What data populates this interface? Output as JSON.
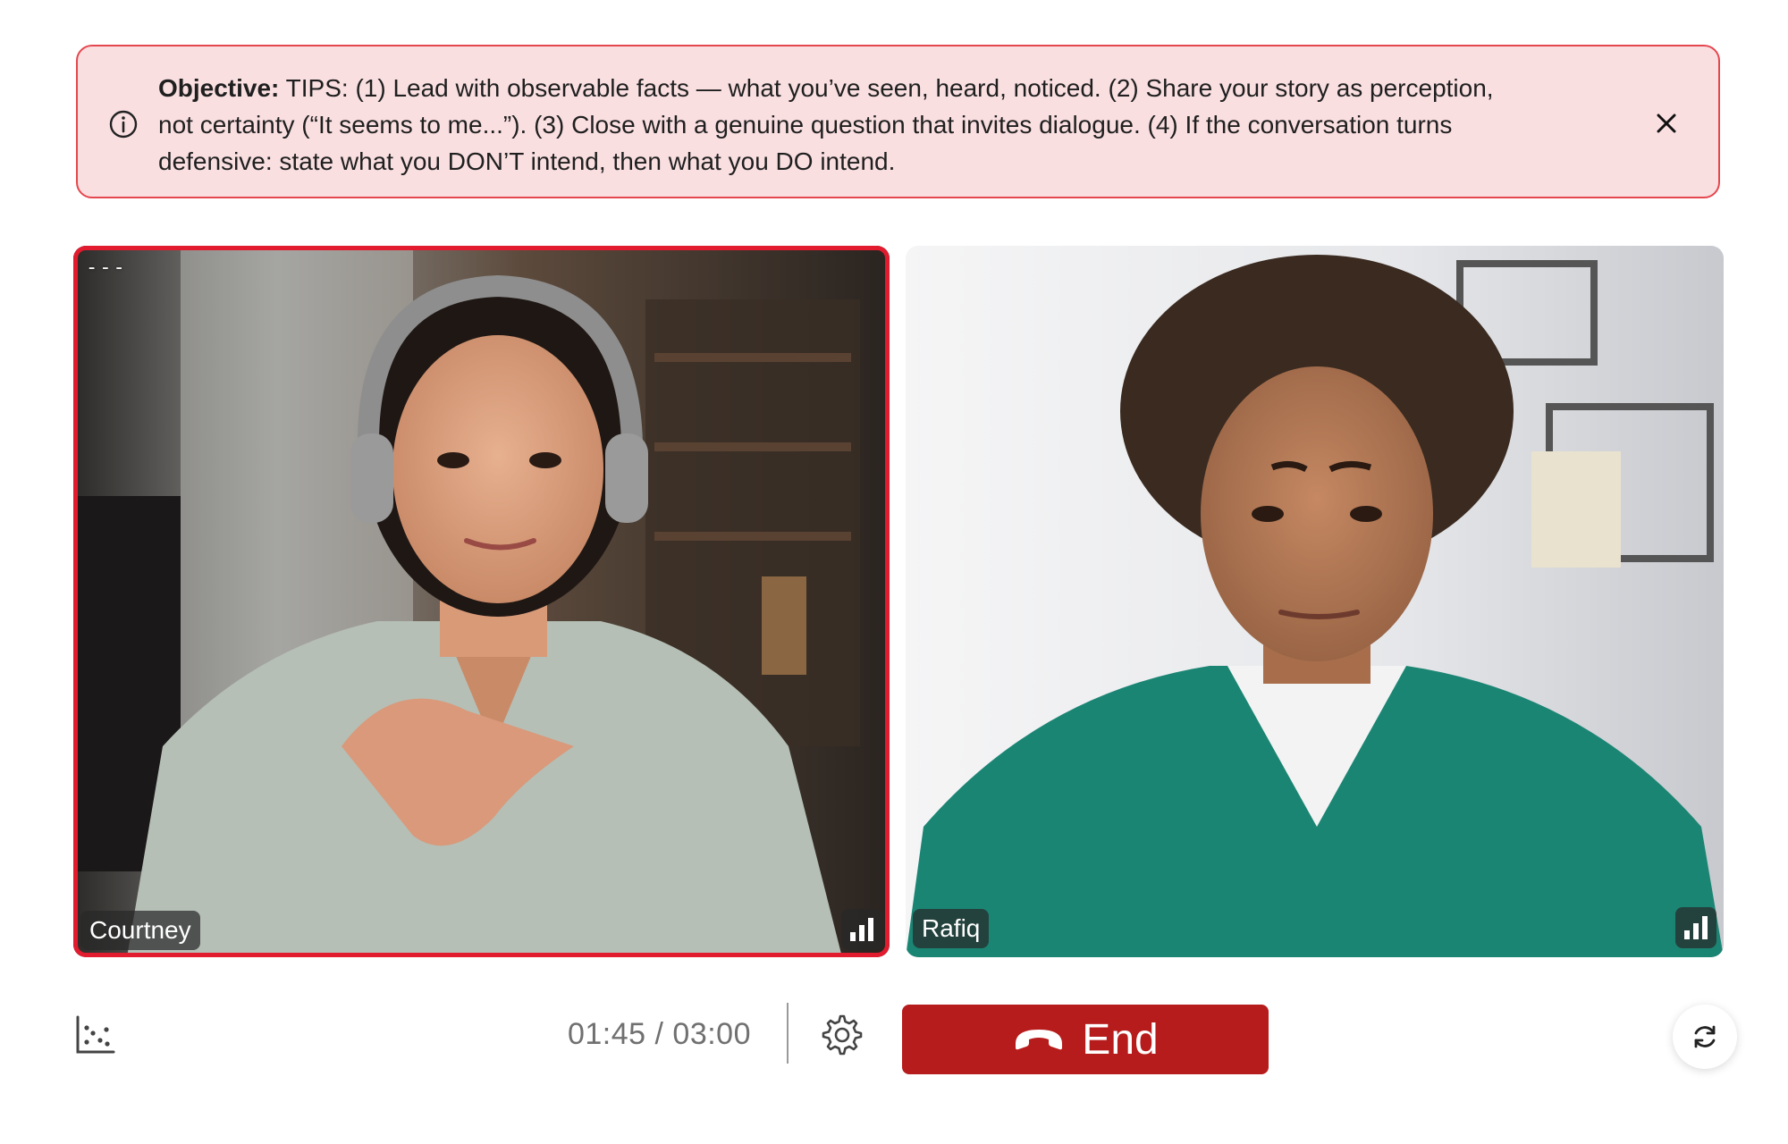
{
  "banner": {
    "label": "Objective:",
    "text": "TIPS: (1) Lead with observable facts — what you’ve seen, heard, noticed. (2) Share your story as perception, not certainty (“It seems to me...”). (3) Close with a genuine question that invites dialogue. (4) If the conversation turns defensive: state what you DON’T intend, then what you DO intend.",
    "info_icon": "info-circle-icon",
    "close_icon": "close-icon",
    "accent": "#e5474f",
    "background": "#fadfe1"
  },
  "participants": [
    {
      "name": "Courtney",
      "status_text": "---",
      "active": true,
      "signal_icon": "signal-bars-icon"
    },
    {
      "name": "Rafiq",
      "active": false,
      "signal_icon": "signal-bars-icon"
    }
  ],
  "controls": {
    "timer": "01:45 / 03:00",
    "end_label": "End",
    "end_color": "#b71c1c",
    "chart_icon": "scatter-chart-icon",
    "settings_icon": "gear-icon",
    "phone_icon": "phone-hangup-icon",
    "refresh_icon": "refresh-icon"
  },
  "active_border_color": "#e21b2e"
}
